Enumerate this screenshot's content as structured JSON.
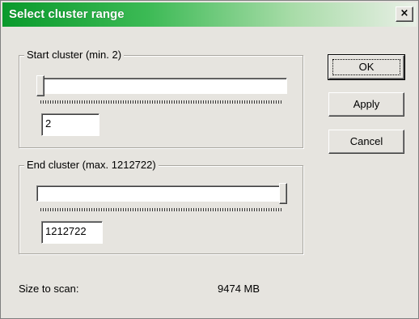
{
  "window": {
    "title": "Select cluster range",
    "close_glyph": "×"
  },
  "start_group": {
    "label": "Start cluster (min. 2)",
    "value": "2",
    "slider_fraction": 0.0
  },
  "end_group": {
    "label": "End cluster (max. 1212722)",
    "value": "1212722",
    "slider_fraction": 1.0
  },
  "buttons": {
    "ok": "OK",
    "apply": "Apply",
    "cancel": "Cancel"
  },
  "size": {
    "label": "Size to scan:",
    "value": "9474 MB"
  },
  "colors": {
    "title_start": "#0a9a2c",
    "dialog_bg": "#e6e4df"
  }
}
